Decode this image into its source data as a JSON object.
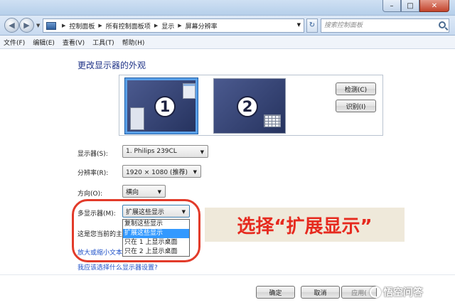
{
  "window": {
    "minimize_glyph": "–",
    "maximize_glyph": "□",
    "close_glyph": "✕"
  },
  "address": {
    "crumbs": [
      "控制面板",
      "所有控制面板项",
      "显示",
      "屏幕分辨率"
    ],
    "search_placeholder": "搜索控制面板"
  },
  "menu": {
    "items": [
      "文件(F)",
      "编辑(E)",
      "查看(V)",
      "工具(T)",
      "帮助(H)"
    ]
  },
  "main": {
    "heading": "更改显示器的外观",
    "monitor1_number": "1",
    "monitor2_number": "2",
    "detect_button": "检测(C)",
    "identify_button": "识别(I)"
  },
  "form": {
    "display_label": "显示器(S):",
    "display_value": "1. Philips 239CL",
    "resolution_label": "分辨率(R):",
    "resolution_value": "1920 × 1080 (推荐)",
    "orientation_label": "方向(O):",
    "orientation_value": "横向",
    "multi_label": "多显示器(M):",
    "multi_value": "扩展这些显示",
    "multi_options": [
      "复制这些显示",
      "扩展这些显示",
      "只在 1 上显示桌面",
      "只在 2 上显示桌面"
    ]
  },
  "text": {
    "current_partial": "这是您当前的主",
    "link_resize_partial": "放大或缩小文本",
    "link_which_settings": "我应该选择什么显示器设置?"
  },
  "callout": {
    "text": "选择“扩展显示”"
  },
  "buttons": {
    "ok": "确定",
    "cancel": "取消",
    "apply_partial": "应用("
  },
  "watermark": {
    "text": "悟空问答"
  },
  "colors": {
    "accent_red": "#e62a1f",
    "link_blue": "#1f50c8",
    "heading_blue": "#1e3287",
    "selection_blue": "#3399ff"
  }
}
